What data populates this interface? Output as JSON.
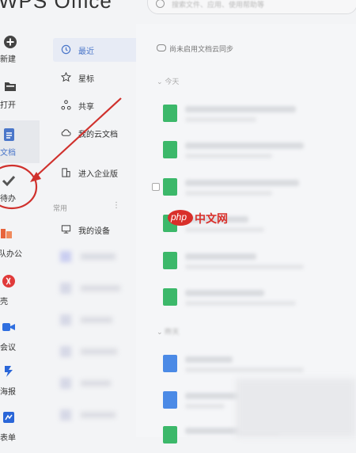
{
  "app": {
    "title": "WPS Office",
    "search_placeholder": "搜索文件、应用、使用帮助等"
  },
  "rail": [
    {
      "label": "新建",
      "icon": "plus-circle-icon"
    },
    {
      "label": "打开",
      "icon": "folder-icon"
    },
    {
      "label": "文档",
      "icon": "document-icon",
      "active": true
    },
    {
      "label": "待办",
      "icon": "check-icon"
    },
    {
      "label": "团队办公",
      "icon": "team-icon"
    },
    {
      "label": "稻壳",
      "icon": "dako-icon"
    },
    {
      "label": "金山会议",
      "icon": "meeting-icon"
    },
    {
      "label": "金山海报",
      "icon": "poster-icon"
    },
    {
      "label": "计表单",
      "icon": "form-icon"
    }
  ],
  "nav": {
    "items": [
      {
        "label": "最近",
        "icon": "clock-icon",
        "active": true
      },
      {
        "label": "星标",
        "icon": "star-icon"
      },
      {
        "label": "共享",
        "icon": "share-icon"
      },
      {
        "label": "我的云文档",
        "icon": "cloud-icon"
      },
      {
        "label": "进入企业版",
        "icon": "building-icon"
      }
    ],
    "section_label": "常用",
    "device": {
      "label": "我的设备",
      "icon": "device-icon"
    }
  },
  "main": {
    "sync_text": "尚未启用文档云同步",
    "group_today": "今天",
    "group_yesterday": "昨天"
  },
  "watermark": {
    "text": "中文网"
  },
  "colors": {
    "accent": "#4a76c9",
    "annotation": "#d0312d",
    "doc_green": "#3cb86a",
    "doc_blue": "#4b8ae6"
  }
}
